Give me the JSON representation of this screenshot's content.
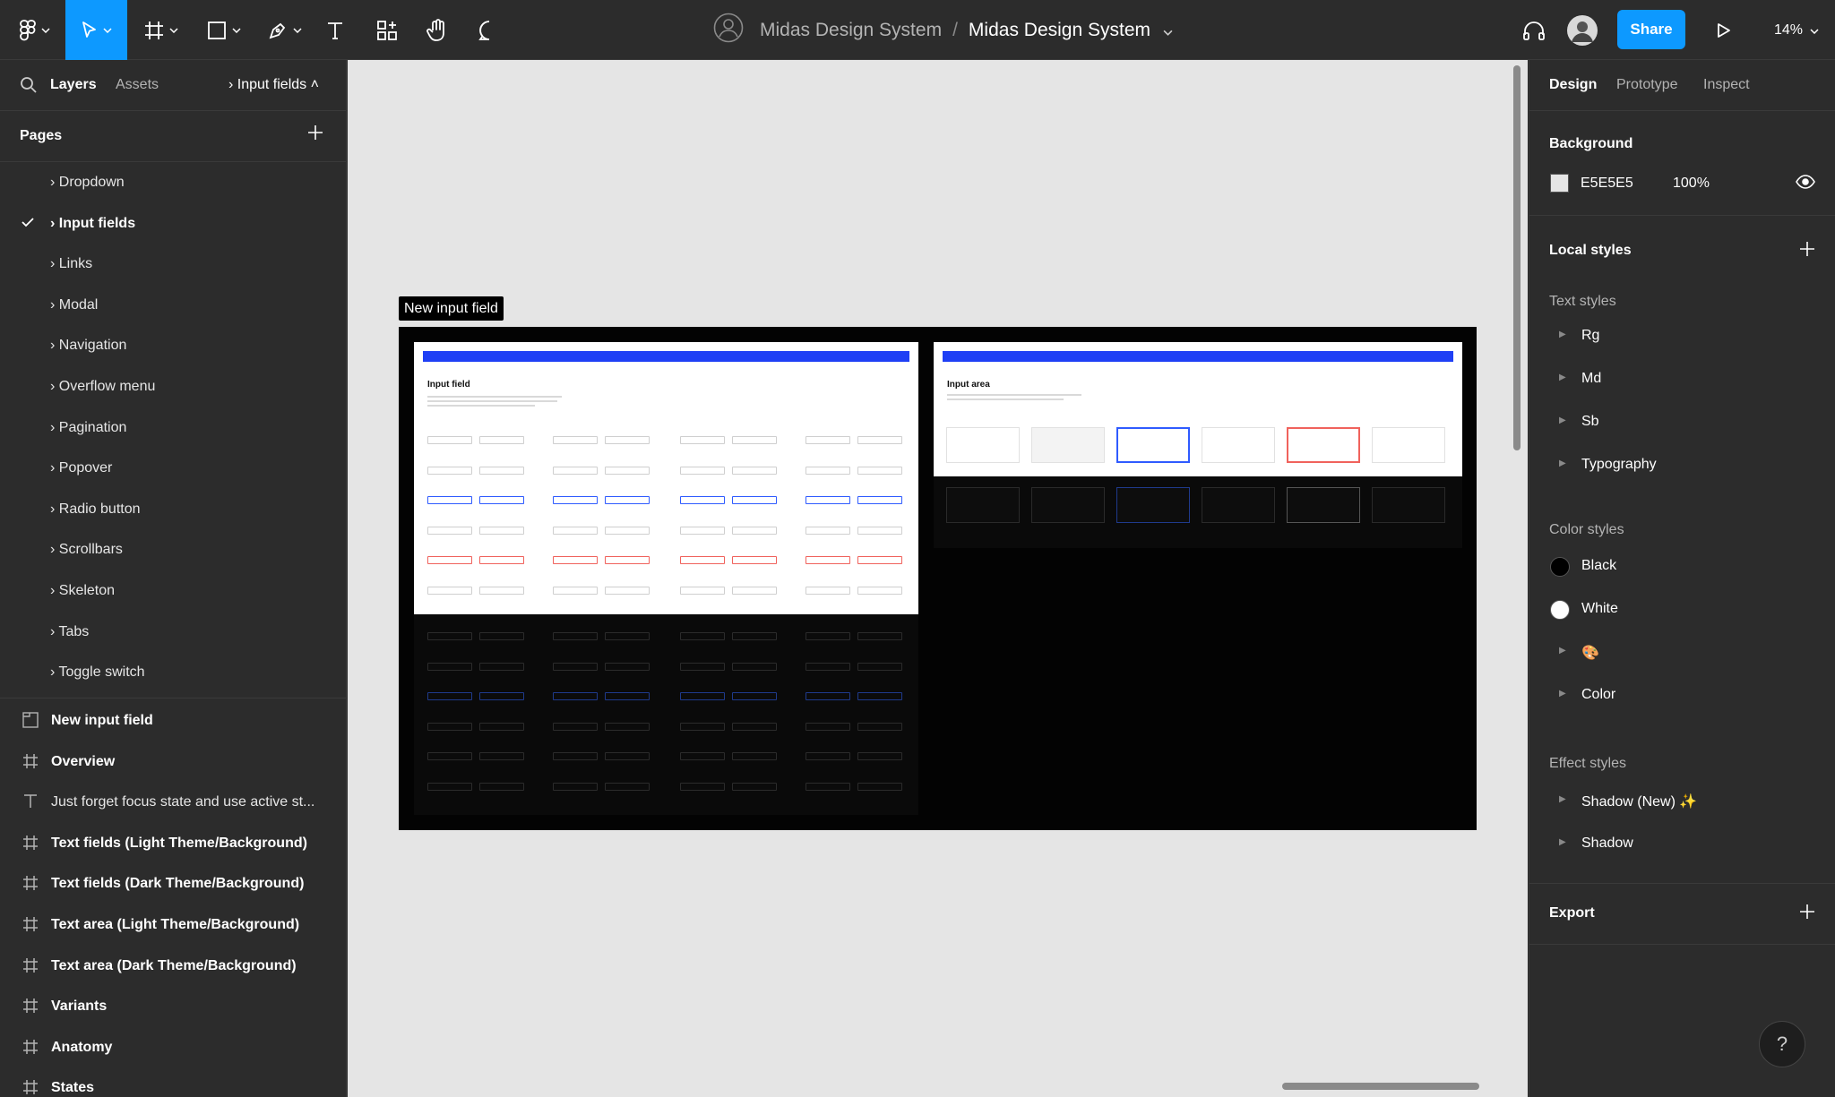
{
  "toolbar": {
    "team_name": "Midas Design System",
    "separator": "/",
    "file_name": "Midas Design System",
    "share_label": "Share",
    "zoom_label": "14%"
  },
  "left_panel": {
    "tabs": {
      "layers": "Layers",
      "assets": "Assets"
    },
    "current_page_label": "› Input fields ˄",
    "pages_label": "Pages",
    "pages": [
      {
        "label": "› Dropdown",
        "current": false
      },
      {
        "label": "› Input fields",
        "current": true
      },
      {
        "label": "› Links",
        "current": false
      },
      {
        "label": "› Modal",
        "current": false
      },
      {
        "label": "› Navigation",
        "current": false
      },
      {
        "label": "› Overflow menu",
        "current": false
      },
      {
        "label": "› Pagination",
        "current": false
      },
      {
        "label": "› Popover",
        "current": false
      },
      {
        "label": "› Radio button",
        "current": false
      },
      {
        "label": "› Scrollbars",
        "current": false
      },
      {
        "label": "› Skeleton",
        "current": false
      },
      {
        "label": "› Tabs",
        "current": false
      },
      {
        "label": "› Toggle switch",
        "current": false
      }
    ],
    "layers": [
      {
        "label": "New input field",
        "icon": "section-icon"
      },
      {
        "label": "Overview",
        "icon": "frame-icon"
      },
      {
        "label": "Just forget focus state and use active st...",
        "icon": "text-icon"
      },
      {
        "label": "Text fields (Light Theme/Background)",
        "icon": "frame-icon"
      },
      {
        "label": "Text fields (Dark Theme/Background)",
        "icon": "frame-icon"
      },
      {
        "label": "Text area (Light Theme/Background)",
        "icon": "frame-icon"
      },
      {
        "label": "Text area (Dark Theme/Background)",
        "icon": "frame-icon"
      },
      {
        "label": "Variants",
        "icon": "frame-icon"
      },
      {
        "label": "Anatomy",
        "icon": "frame-icon"
      },
      {
        "label": "States",
        "icon": "frame-icon"
      }
    ]
  },
  "canvas": {
    "background": "#e5e5e5",
    "frame_label": "New input field",
    "card_left_title": "Input field",
    "card_right_title": "Input area"
  },
  "right_panel": {
    "tabs": {
      "design": "Design",
      "prototype": "Prototype",
      "inspect": "Inspect"
    },
    "background_label": "Background",
    "background_hex": "E5E5E5",
    "background_opacity": "100%",
    "local_styles_label": "Local styles",
    "text_styles_label": "Text styles",
    "text_styles": [
      "Rg",
      "Md",
      "Sb",
      "Typography"
    ],
    "color_styles_label": "Color styles",
    "color_styles": [
      {
        "label": "Black",
        "color": "#000000"
      },
      {
        "label": "White",
        "color": "#ffffff"
      },
      {
        "label": "🎨",
        "color": ""
      },
      {
        "label": "Color",
        "color": ""
      }
    ],
    "effect_styles_label": "Effect styles",
    "effect_styles": [
      "Shadow (New) ✨",
      "Shadow"
    ],
    "export_label": "Export"
  },
  "help_label": "?",
  "colors": {
    "accent": "#0d99ff",
    "panel": "#2c2c2c",
    "canvas": "#e5e5e5",
    "brand_blue": "#1f3ff5"
  }
}
